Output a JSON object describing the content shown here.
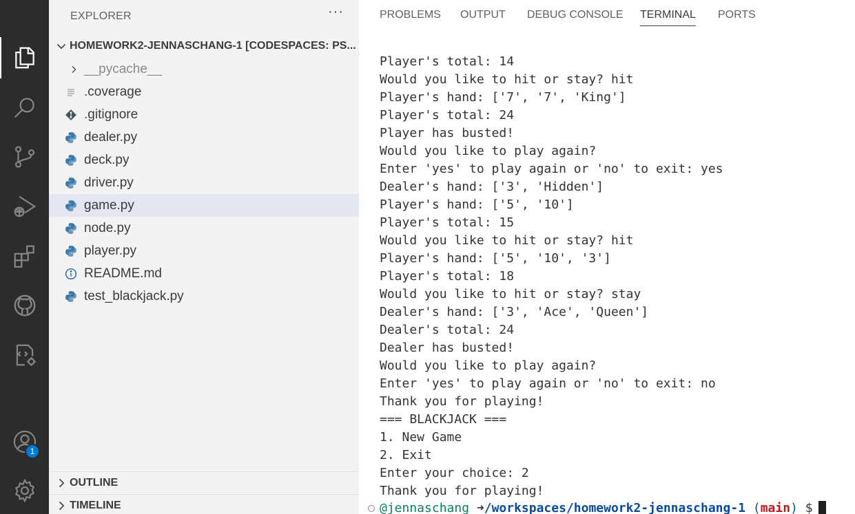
{
  "activity_bar": {
    "items": [
      {
        "name": "explorer-icon"
      },
      {
        "name": "search-icon"
      },
      {
        "name": "source-control-icon"
      },
      {
        "name": "run-debug-icon"
      },
      {
        "name": "extensions-icon"
      },
      {
        "name": "github-icon"
      },
      {
        "name": "remote-explorer-icon"
      },
      {
        "name": "accounts-icon"
      },
      {
        "name": "settings-gear-icon"
      }
    ],
    "accounts_badge": "1"
  },
  "sidebar": {
    "title": "EXPLORER",
    "more": "···",
    "folder": "HOMEWORK2-JENNASCHANG-1 [CODESPACES: PS...",
    "files": [
      {
        "label": "__pycache__",
        "icon": "chevron-right-icon"
      },
      {
        "label": ".coverage",
        "icon": "lines-icon"
      },
      {
        "label": ".gitignore",
        "icon": "git-icon"
      },
      {
        "label": "dealer.py",
        "icon": "python-icon"
      },
      {
        "label": "deck.py",
        "icon": "python-icon"
      },
      {
        "label": "driver.py",
        "icon": "python-icon"
      },
      {
        "label": "game.py",
        "icon": "python-icon"
      },
      {
        "label": "node.py",
        "icon": "python-icon"
      },
      {
        "label": "player.py",
        "icon": "python-icon"
      },
      {
        "label": "README.md",
        "icon": "info-icon"
      },
      {
        "label": "test_blackjack.py",
        "icon": "python-icon"
      }
    ],
    "outline": "OUTLINE",
    "timeline": "TIMELINE"
  },
  "panel": {
    "tabs": [
      "PROBLEMS",
      "OUTPUT",
      "DEBUG CONSOLE",
      "TERMINAL",
      "PORTS"
    ],
    "terminal_lines": [
      "Player's total: 14",
      "Would you like to hit or stay? hit",
      "Player's hand: ['7', '7', 'King']",
      "Player's total: 24",
      "Player has busted!",
      "Would you like to play again?",
      "Enter 'yes' to play again or 'no' to exit: yes",
      "Dealer's hand: ['3', 'Hidden']",
      "Player's hand: ['5', '10']",
      "Player's total: 15",
      "Would you like to hit or stay? hit",
      "Player's hand: ['5', '10', '3']",
      "Player's total: 18",
      "Would you like to hit or stay? stay",
      "Dealer's hand: ['3', 'Ace', 'Queen']",
      "Dealer's total: 24",
      "Dealer has busted!",
      "Would you like to play again?",
      "Enter 'yes' to play again or 'no' to exit: no",
      "Thank you for playing!",
      "=== BLACKJACK ===",
      "1. New Game",
      "2. Exit",
      "Enter your choice: 2",
      "Thank you for playing!"
    ],
    "prompt": {
      "user": "@jennaschang",
      "arrow": "➜",
      "path": "/workspaces/homework2-jennaschang-1",
      "branch_open": "(",
      "branch": "main",
      "branch_close": ")",
      "dollar": "$"
    }
  }
}
